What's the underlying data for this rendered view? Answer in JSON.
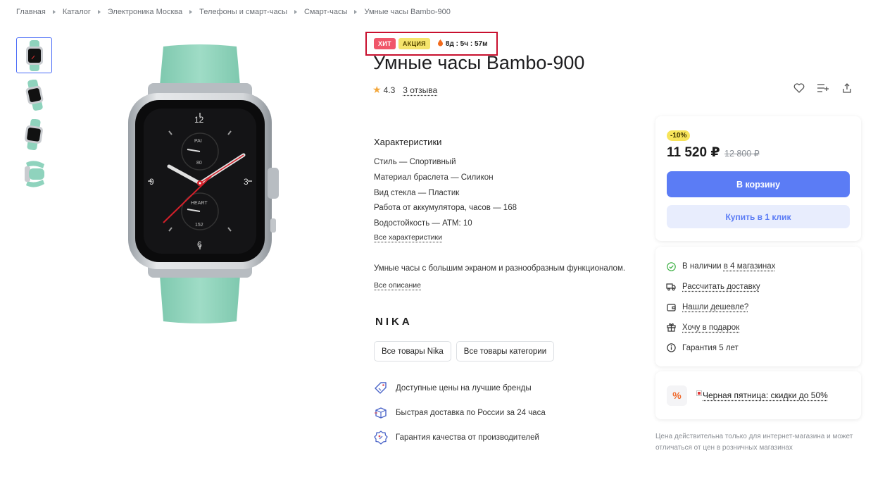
{
  "breadcrumb": [
    "Главная",
    "Каталог",
    "Электроника Москва",
    "Телефоны и смарт-часы",
    "Смарт-часы",
    "Умные часы Bambo-900"
  ],
  "badges": {
    "hit": "ХИТ",
    "promo": "АКЦИЯ",
    "timer": "8д : 5ч : 57м"
  },
  "product": {
    "title": "Умные часы Bambo-900",
    "rating": "4.3",
    "reviews": "3 отзыва"
  },
  "watch_face": {
    "top": "12",
    "bottom": "6",
    "left": "9",
    "right": "3",
    "sub_top": "PAI",
    "sub_top_val": "80",
    "sub_bottom": "HEART",
    "sub_bottom_val": "152"
  },
  "specs": {
    "title": "Характеристики",
    "items": [
      "Стиль — Спортивный",
      "Материал браслета — Силикон",
      "Вид стекла — Пластик",
      "Работа от аккумулятора, часов — 168",
      "Водостойкость — ATM: 10"
    ],
    "all_link": "Все характеристики"
  },
  "description": {
    "text": "Умные часы с большим экраном и разнообразным функционалом.",
    "all_link": "Все описание"
  },
  "brand": "NIKA",
  "chips": [
    "Все товары Nika",
    "Все товары категории"
  ],
  "features": [
    {
      "icon": "price-tag-icon",
      "text": "Доступные цены на лучшие бренды"
    },
    {
      "icon": "delivery-box-icon",
      "text": "Быстрая доставка по России за 24 часа"
    },
    {
      "icon": "quality-badge-icon",
      "text": "Гарантия качества от производителей"
    }
  ],
  "purchase": {
    "discount": "-10%",
    "price": "11 520 ₽",
    "old_price": "12 800 ₽",
    "cart_button": "В корзину",
    "one_click_button": "Купить в 1 клик"
  },
  "info": {
    "stock_prefix": "В наличии",
    "stock_link": "в 4 магазинах",
    "delivery": "Рассчитать доставку",
    "cheaper": "Нашли дешевле?",
    "gift": "Хочу в подарок",
    "warranty": "Гарантия 5 лет"
  },
  "promo": {
    "icon_text": "%",
    "text": "Черная пятница: скидки до 50%"
  },
  "note": "Цена действительна только для интернет-магазина и может отличаться от цен в розничных магазинах",
  "colors": {
    "accent": "#5b7cf5",
    "accent_light": "#e8edfd",
    "hit": "#f0566a",
    "promo": "#f5e46c",
    "discount": "#f7e45a",
    "highlight_border": "#c8102e",
    "strap": "#8fd3bd",
    "in_stock": "#3cb043"
  }
}
